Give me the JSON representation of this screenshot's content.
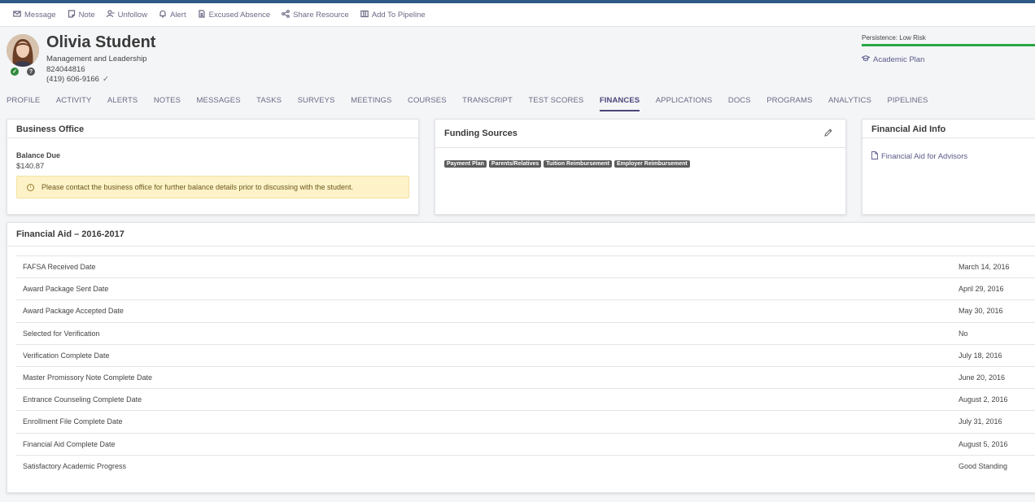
{
  "actions": [
    {
      "label": "Message",
      "icon": "envelope-icon"
    },
    {
      "label": "Note",
      "icon": "note-icon"
    },
    {
      "label": "Unfollow",
      "icon": "unfollow-icon"
    },
    {
      "label": "Alert",
      "icon": "bell-icon"
    },
    {
      "label": "Excused Absence",
      "icon": "document-icon"
    },
    {
      "label": "Share Resource",
      "icon": "share-icon"
    },
    {
      "label": "Add To Pipeline",
      "icon": "pipeline-icon"
    }
  ],
  "student": {
    "name": "Olivia Student",
    "program": "Management and Leadership",
    "id": "824044816",
    "phone": "(419) 606-9166",
    "phone_verified_mark": "✓"
  },
  "persistence": {
    "label": "Persistence: Low Risk",
    "level": 1.0,
    "color": "#2aa845"
  },
  "academic_plan": {
    "label": "Academic Plan",
    "icon": "graduation-cap-icon"
  },
  "tabs": [
    "PROFILE",
    "ACTIVITY",
    "ALERTS",
    "NOTES",
    "MESSAGES",
    "TASKS",
    "SURVEYS",
    "MEETINGS",
    "COURSES",
    "TRANSCRIPT",
    "TEST SCORES",
    "FINANCES",
    "APPLICATIONS",
    "DOCS",
    "PROGRAMS",
    "ANALYTICS",
    "PIPELINES"
  ],
  "active_tab": "FINANCES",
  "business_office": {
    "title": "Business Office",
    "balance_label": "Balance Due",
    "balance_value": "$140.87",
    "notice": "Please contact the business office for further balance details prior to discussing with the student."
  },
  "funding_sources": {
    "title": "Funding Sources",
    "tags": [
      "Payment Plan",
      "Parents/Relatives",
      "Tuition Reimbursement",
      "Employer Reimbursement"
    ]
  },
  "financial_aid_info": {
    "title": "Financial Aid Info",
    "link": "Financial Aid for Advisors"
  },
  "financial_aid": {
    "title": "Financial Aid – 2016-2017",
    "rows": [
      {
        "label": "FAFSA Received Date",
        "value": "March 14, 2016"
      },
      {
        "label": "Award Package Sent Date",
        "value": "April 29, 2016"
      },
      {
        "label": "Award Package Accepted Date",
        "value": "May 30, 2016"
      },
      {
        "label": "Selected for Verification",
        "value": "No"
      },
      {
        "label": "Verification Complete Date",
        "value": "July 18, 2016"
      },
      {
        "label": "Master Promissory Note Complete Date",
        "value": "June 20, 2016"
      },
      {
        "label": "Entrance Counseling Complete Date",
        "value": "August 2, 2016"
      },
      {
        "label": "Enrollment File Complete Date",
        "value": "July 31, 2016"
      },
      {
        "label": "Financial Aid Complete Date",
        "value": "August 5, 2016"
      },
      {
        "label": "Satisfactory Academic Progress",
        "value": "Good Standing"
      }
    ]
  }
}
